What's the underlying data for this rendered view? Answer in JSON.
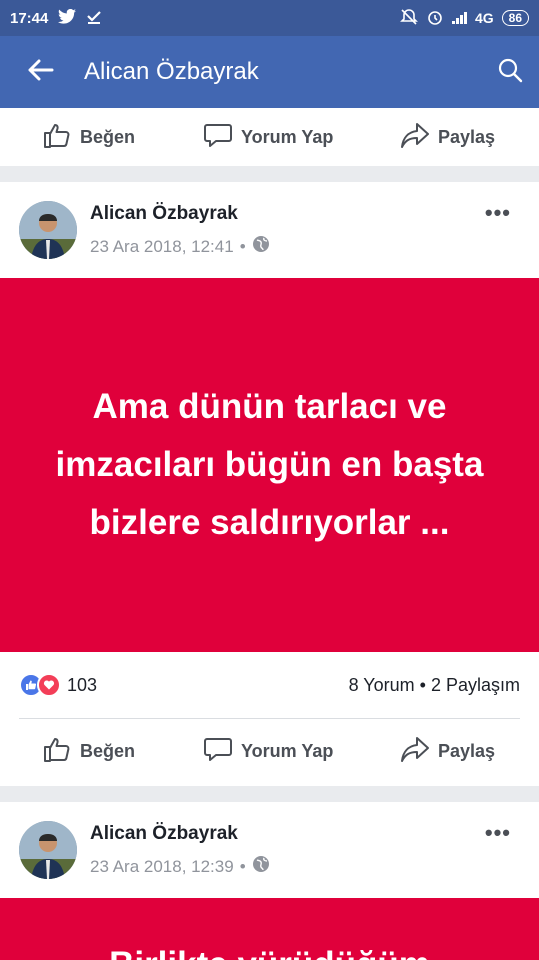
{
  "status": {
    "time": "17:44",
    "network": "4G",
    "battery": "86"
  },
  "app_bar": {
    "title": "Alican Özbayrak"
  },
  "actions": {
    "like": "Beğen",
    "comment": "Yorum Yap",
    "share": "Paylaş"
  },
  "posts": [
    {
      "author": "Alican Özbayrak",
      "date": "23 Ara 2018, 12:41",
      "text": "Ama dünün tarlacı ve imzacıları bügün en başta bizlere saldırıyorlar ...",
      "reactions": "103",
      "comments_shares": "8 Yorum • 2 Paylaşım"
    },
    {
      "author": "Alican Özbayrak",
      "date": "23 Ara 2018, 12:39",
      "text": "Birlikte yürüdüğüm"
    }
  ],
  "colors": {
    "status_bar": "#3b5998",
    "app_bar": "#4267b2",
    "post_background": "#e0003b",
    "like_blue": "#4a76e8",
    "love_red": "#f33e58"
  }
}
